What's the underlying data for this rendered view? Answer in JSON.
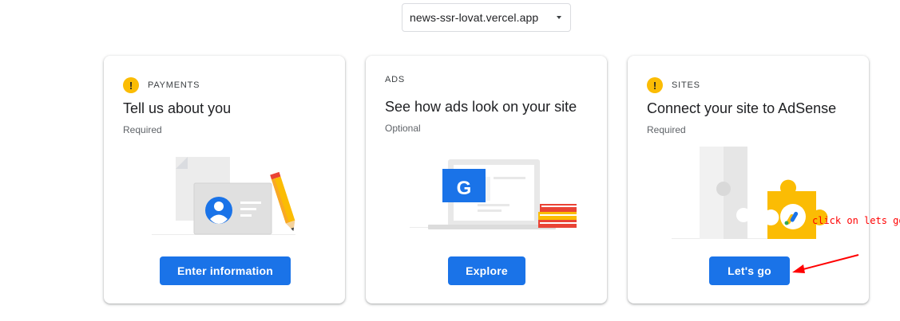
{
  "site_selector": {
    "value": "news-ssr-lovat.vercel.app",
    "icon": "caret-down-icon"
  },
  "cards": [
    {
      "category": "PAYMENTS",
      "status_icon": "warning-icon",
      "title": "Tell us about you",
      "requirement": "Required",
      "button_label": "Enter information",
      "illustration": "id-card-pencil-illustration"
    },
    {
      "category": "ADS",
      "title": "See how ads look on your site",
      "requirement": "Optional",
      "button_label": "Explore",
      "illustration": "laptop-google-books-illustration"
    },
    {
      "category": "SITES",
      "status_icon": "warning-icon",
      "title": "Connect your site to AdSense",
      "requirement": "Required",
      "button_label": "Let's go",
      "illustration": "puzzle-adsense-illustration"
    }
  ],
  "annotation": {
    "text": "click on lets go",
    "color": "#ff0000"
  },
  "colors": {
    "primary_button": "#1a73e8",
    "warning": "#fbbc04"
  }
}
